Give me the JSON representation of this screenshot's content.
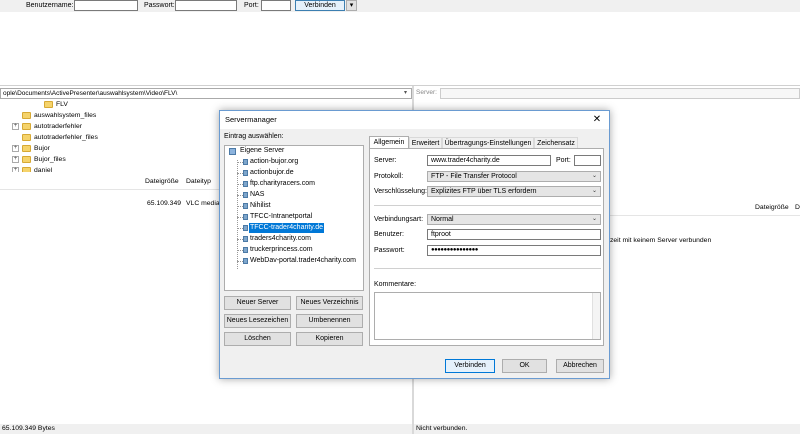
{
  "quickconnect": {
    "username_label": "Benutzername:",
    "password_label": "Passwort:",
    "port_label": "Port:",
    "connect_button": "Verbinden",
    "dropdown_arrow": "▾"
  },
  "local": {
    "path": "ople\\Documents\\ActivePresenter\\auswahlsystem\\Video\\FLV\\",
    "tree": [
      "FLV",
      "auswahlsystem_files",
      "autotraderfehler",
      "autotraderfehler_files",
      "Bujor",
      "Bujor_files",
      "daniel"
    ],
    "columns": {
      "size": "Dateigröße",
      "type": "Dateityp"
    },
    "file": {
      "size": "65.109.349",
      "type": "VLC media"
    },
    "status": "65.109.349 Bytes"
  },
  "remote": {
    "path_label": "Server:",
    "columns": {
      "size": "Dateigröße",
      "type": "D"
    },
    "message": "zeit mit keinem Server verbunden",
    "status": "Nicht verbunden."
  },
  "dialog": {
    "title": "Servermanager",
    "close_icon": "✕",
    "select_entry_label": "Eintrag auswählen:",
    "root": "Eigene Server",
    "servers": [
      "action-bujor.org",
      "actionbujor.de",
      "ftp.charityracers.com",
      "NAS",
      "Nihilist",
      "TFCC-Intranetportal",
      "TFCC-trader4charity.de",
      "traders4charity.com",
      "truckerprincess.com",
      "WebDav-portal.trader4charity.com"
    ],
    "selected_server": "TFCC-trader4charity.de",
    "buttons": {
      "new_server": "Neuer Server",
      "new_folder": "Neues Verzeichnis",
      "new_bookmark": "Neues Lesezeichen",
      "rename": "Umbenennen",
      "delete": "Löschen",
      "copy": "Kopieren",
      "connect": "Verbinden",
      "ok": "OK",
      "cancel": "Abbrechen"
    },
    "tabs": [
      "Allgemein",
      "Erweitert",
      "Übertragungs-Einstellungen",
      "Zeichensatz"
    ],
    "active_tab": "Allgemein",
    "form": {
      "server_label": "Server:",
      "server_value": "www.trader4charity.de",
      "port_label": "Port:",
      "port_value": "",
      "protocol_label": "Protokoll:",
      "protocol_value": "FTP - File Transfer Protocol",
      "encryption_label": "Verschlüsselung:",
      "encryption_value": "Explizites FTP über TLS erfordern",
      "logon_label": "Verbindungsart:",
      "logon_value": "Normal",
      "user_label": "Benutzer:",
      "user_value": "ftproot",
      "password_label": "Passwort:",
      "password_value": "●●●●●●●●●●●●●●●",
      "comments_label": "Kommentare:"
    }
  }
}
